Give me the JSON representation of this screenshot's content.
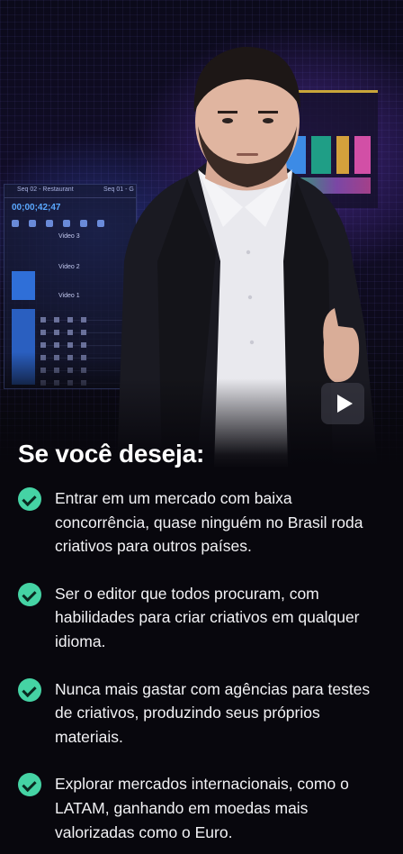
{
  "hero": {
    "editor": {
      "seq_tab_1": "Seq 02 - Restaurant",
      "seq_tab_2": "Seq 01 - G",
      "timecode": "00;00;42;47",
      "track_video_3": "Video 3",
      "track_video_2": "Video 2",
      "track_video_1": "Video 1"
    },
    "play_button_icon": "play-icon"
  },
  "headline": "Se você deseja:",
  "benefits": [
    {
      "icon": "check-circle-icon",
      "text": "Entrar em um mercado com baixa concorrência, quase ninguém no Brasil roda criativos para outros países."
    },
    {
      "icon": "check-circle-icon",
      "text": "Ser o editor que todos procuram, com habilidades para criar criativos em qualquer idioma."
    },
    {
      "icon": "check-circle-icon",
      "text": "Nunca mais gastar com agências para testes de criativos, produzindo seus próprios materiais."
    },
    {
      "icon": "check-circle-icon",
      "text": "Explorar mercados internacionais, como o LATAM, ganhando em moedas mais valorizadas como o Euro."
    }
  ],
  "colors": {
    "background": "#08070d",
    "check_accent": "#45d3a4",
    "timecode_blue": "#5aa8ff"
  }
}
